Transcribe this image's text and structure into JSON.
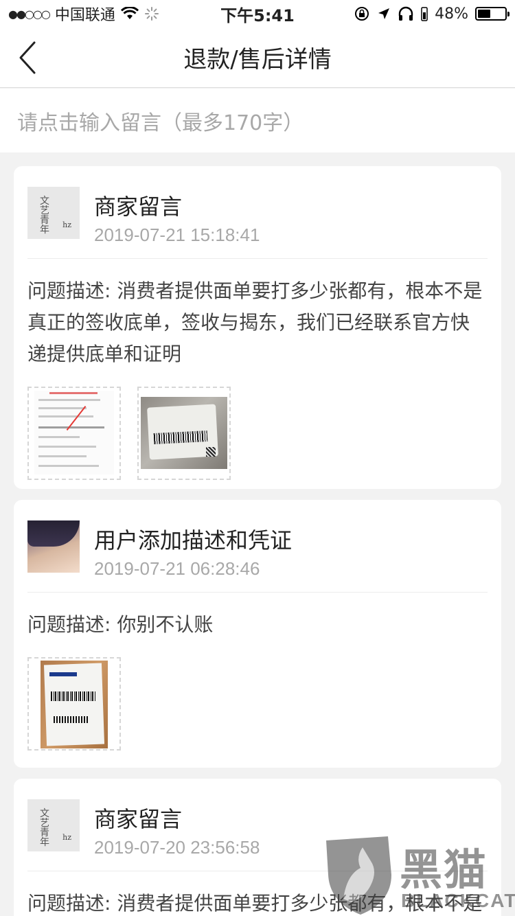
{
  "status_bar": {
    "signal_dots": "●●○○○",
    "carrier": "中国联通",
    "time": "下午5:41",
    "battery": "48%",
    "battery_fraction": 0.48
  },
  "nav": {
    "title": "退款/售后详情",
    "back_icon": "chevron-left-icon"
  },
  "message_input": {
    "placeholder": "请点击输入留言（最多170字）"
  },
  "messages": [
    {
      "name": "商家留言",
      "time": "2019-07-21 15:18:41",
      "avatar": "merchant-avatar",
      "avatar_text": "文艺青年",
      "avatar_sub": "hz",
      "description": "问题描述: 消费者提供面单要打多少张都有，根本不是真正的签收底单，签收与揭东，我们已经联系官方快递提供底单和证明",
      "attachments": [
        "document-screenshot",
        "express-bag-photo"
      ]
    },
    {
      "name": "用户添加描述和凭证",
      "time": "2019-07-21 06:28:46",
      "avatar": "user-avatar",
      "description": "问题描述: 你别不认账",
      "attachments": [
        "shipping-label-photo"
      ]
    },
    {
      "name": "商家留言",
      "time": "2019-07-20 23:56:58",
      "avatar": "merchant-avatar",
      "avatar_text": "文艺青年",
      "avatar_sub": "hz",
      "description": "问题描述: 消费者提供面单要打多少张都有，根本不是"
    }
  ],
  "watermark": {
    "cn": "黑猫",
    "en": "BLACKCAT"
  }
}
